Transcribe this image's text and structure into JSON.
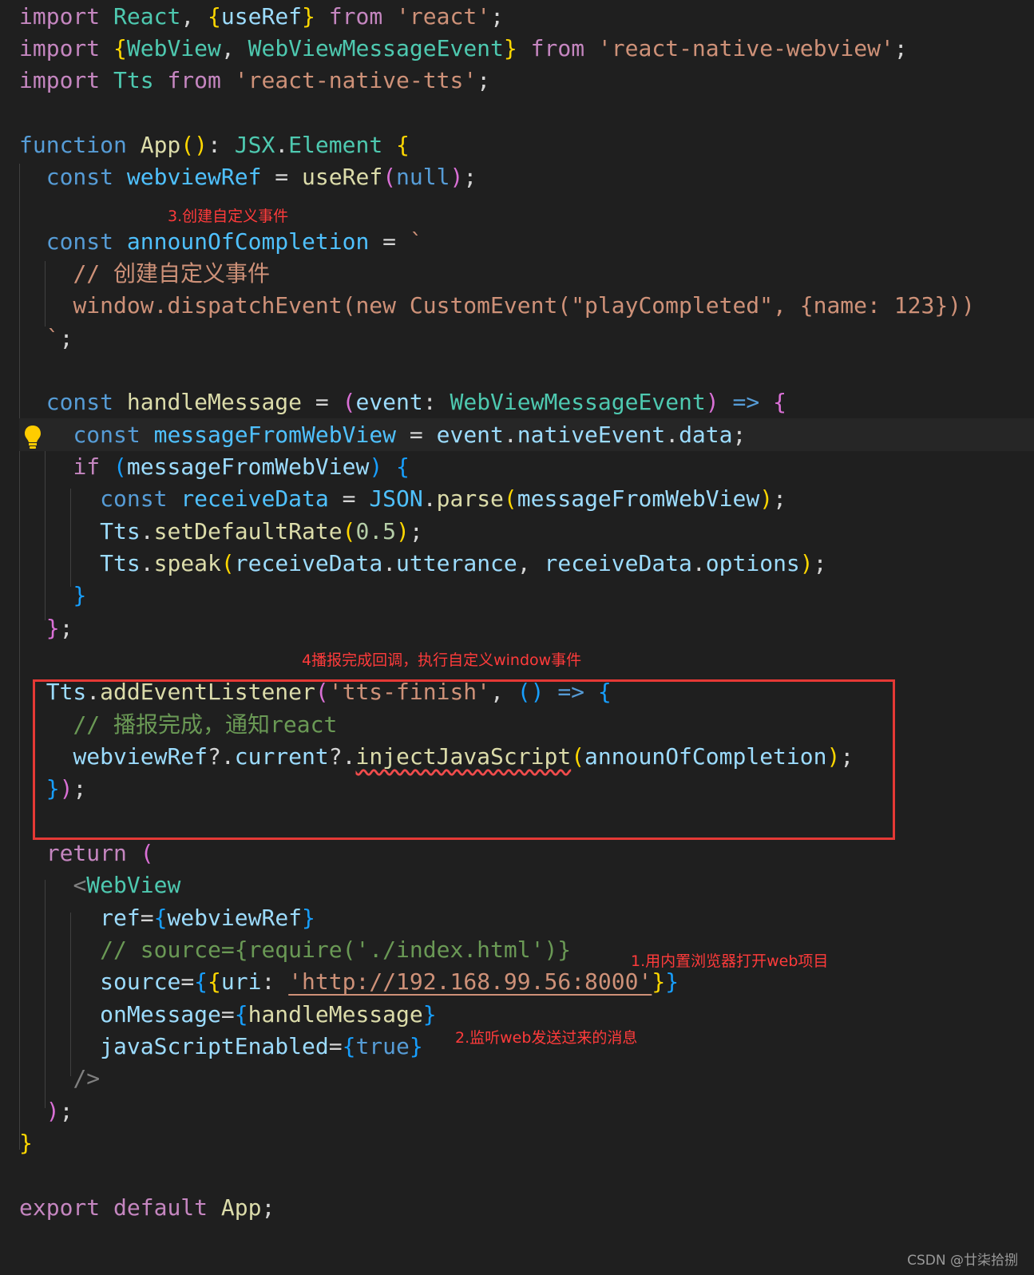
{
  "colors": {
    "background": "#1f1f1f",
    "keyword": "#c586c0",
    "storage": "#569cd6",
    "variable": "#9cdcfe",
    "constant": "#4fc1ff",
    "function": "#dcdcaa",
    "type": "#4ec9b0",
    "string": "#ce9178",
    "number": "#b5cea8",
    "comment": "#6a9955",
    "plain": "#d4d4d4",
    "bracket1": "#ffd700",
    "bracket2": "#da70d6",
    "bracket3": "#179fff",
    "annotation": "#ff3b3b"
  },
  "code_lines": [
    [
      [
        "k",
        "import"
      ],
      [
        "p",
        " "
      ],
      [
        "t",
        "React"
      ],
      [
        "p",
        ", "
      ],
      [
        "b1",
        "{"
      ],
      [
        "v",
        "useRef"
      ],
      [
        "b1",
        "}"
      ],
      [
        "p",
        " "
      ],
      [
        "k",
        "from"
      ],
      [
        "p",
        " "
      ],
      [
        "s",
        "'react'"
      ],
      [
        "p",
        ";"
      ]
    ],
    [
      [
        "k",
        "import"
      ],
      [
        "p",
        " "
      ],
      [
        "b1",
        "{"
      ],
      [
        "t",
        "WebView"
      ],
      [
        "p",
        ", "
      ],
      [
        "t",
        "WebViewMessageEvent"
      ],
      [
        "b1",
        "}"
      ],
      [
        "p",
        " "
      ],
      [
        "k",
        "from"
      ],
      [
        "p",
        " "
      ],
      [
        "s",
        "'react-native-webview'"
      ],
      [
        "p",
        ";"
      ]
    ],
    [
      [
        "k",
        "import"
      ],
      [
        "p",
        " "
      ],
      [
        "t",
        "Tts"
      ],
      [
        "p",
        " "
      ],
      [
        "k",
        "from"
      ],
      [
        "p",
        " "
      ],
      [
        "s",
        "'react-native-tts'"
      ],
      [
        "p",
        ";"
      ]
    ],
    [],
    [
      [
        "st",
        "function"
      ],
      [
        "p",
        " "
      ],
      [
        "f",
        "App"
      ],
      [
        "b1",
        "()"
      ],
      [
        "p",
        ": "
      ],
      [
        "t",
        "JSX"
      ],
      [
        "p",
        "."
      ],
      [
        "t",
        "Element"
      ],
      [
        "p",
        " "
      ],
      [
        "b1",
        "{"
      ]
    ],
    [
      [
        "p",
        "  "
      ],
      [
        "st",
        "const"
      ],
      [
        "p",
        " "
      ],
      [
        "c",
        "webviewRef"
      ],
      [
        "p",
        " = "
      ],
      [
        "f",
        "useRef"
      ],
      [
        "b2",
        "("
      ],
      [
        "st",
        "null"
      ],
      [
        "b2",
        ")"
      ],
      [
        "p",
        ";"
      ]
    ],
    [],
    [
      [
        "p",
        "  "
      ],
      [
        "st",
        "const"
      ],
      [
        "p",
        " "
      ],
      [
        "c",
        "announOfCompletion"
      ],
      [
        "p",
        " = "
      ],
      [
        "s",
        "`"
      ]
    ],
    [
      [
        "p",
        "    "
      ],
      [
        "s",
        "// 创建自定义事件"
      ]
    ],
    [
      [
        "p",
        "    "
      ],
      [
        "s",
        "window.dispatchEvent(new CustomEvent(\"playCompleted\", {name: 123}))"
      ]
    ],
    [
      [
        "p",
        "  "
      ],
      [
        "s",
        "`"
      ],
      [
        "p",
        ";"
      ]
    ],
    [],
    [
      [
        "p",
        "  "
      ],
      [
        "st",
        "const"
      ],
      [
        "p",
        " "
      ],
      [
        "f",
        "handleMessage"
      ],
      [
        "p",
        " = "
      ],
      [
        "b2",
        "("
      ],
      [
        "v",
        "event"
      ],
      [
        "p",
        ": "
      ],
      [
        "t",
        "WebViewMessageEvent"
      ],
      [
        "b2",
        ")"
      ],
      [
        "p",
        " "
      ],
      [
        "st",
        "=>"
      ],
      [
        "p",
        " "
      ],
      [
        "b2",
        "{"
      ]
    ],
    [
      [
        "p",
        "    "
      ],
      [
        "st",
        "const"
      ],
      [
        "p",
        " "
      ],
      [
        "c",
        "messageFromWebView"
      ],
      [
        "p",
        " = "
      ],
      [
        "v",
        "event"
      ],
      [
        "p",
        "."
      ],
      [
        "v",
        "nativeEvent"
      ],
      [
        "p",
        "."
      ],
      [
        "v",
        "data"
      ],
      [
        "p",
        ";"
      ]
    ],
    [
      [
        "p",
        "    "
      ],
      [
        "k",
        "if"
      ],
      [
        "p",
        " "
      ],
      [
        "b3",
        "("
      ],
      [
        "v",
        "messageFromWebView"
      ],
      [
        "b3",
        ")"
      ],
      [
        "p",
        " "
      ],
      [
        "b3",
        "{"
      ]
    ],
    [
      [
        "p",
        "      "
      ],
      [
        "st",
        "const"
      ],
      [
        "p",
        " "
      ],
      [
        "c",
        "receiveData"
      ],
      [
        "p",
        " = "
      ],
      [
        "c",
        "JSON"
      ],
      [
        "p",
        "."
      ],
      [
        "f",
        "parse"
      ],
      [
        "b1",
        "("
      ],
      [
        "v",
        "messageFromWebView"
      ],
      [
        "b1",
        ")"
      ],
      [
        "p",
        ";"
      ]
    ],
    [
      [
        "p",
        "      "
      ],
      [
        "v",
        "Tts"
      ],
      [
        "p",
        "."
      ],
      [
        "f",
        "setDefaultRate"
      ],
      [
        "b1",
        "("
      ],
      [
        "n",
        "0.5"
      ],
      [
        "b1",
        ")"
      ],
      [
        "p",
        ";"
      ]
    ],
    [
      [
        "p",
        "      "
      ],
      [
        "v",
        "Tts"
      ],
      [
        "p",
        "."
      ],
      [
        "f",
        "speak"
      ],
      [
        "b1",
        "("
      ],
      [
        "v",
        "receiveData"
      ],
      [
        "p",
        "."
      ],
      [
        "v",
        "utterance"
      ],
      [
        "p",
        ", "
      ],
      [
        "v",
        "receiveData"
      ],
      [
        "p",
        "."
      ],
      [
        "v",
        "options"
      ],
      [
        "b1",
        ")"
      ],
      [
        "p",
        ";"
      ]
    ],
    [
      [
        "p",
        "    "
      ],
      [
        "b3",
        "}"
      ]
    ],
    [
      [
        "p",
        "  "
      ],
      [
        "b2",
        "}"
      ],
      [
        "p",
        ";"
      ]
    ],
    [],
    [
      [
        "p",
        "  "
      ],
      [
        "v",
        "Tts"
      ],
      [
        "p",
        "."
      ],
      [
        "f",
        "addEventListener"
      ],
      [
        "b2",
        "("
      ],
      [
        "s",
        "'tts-finish'"
      ],
      [
        "p",
        ", "
      ],
      [
        "b3",
        "()"
      ],
      [
        "p",
        " "
      ],
      [
        "st",
        "=>"
      ],
      [
        "p",
        " "
      ],
      [
        "b3",
        "{"
      ]
    ],
    [
      [
        "p",
        "    "
      ],
      [
        "cm",
        "// 播报完成，通知react"
      ]
    ],
    [
      [
        "p",
        "    "
      ],
      [
        "v",
        "webviewRef"
      ],
      [
        "p",
        "?."
      ],
      [
        "v",
        "current"
      ],
      [
        "p",
        "?."
      ],
      [
        "fq",
        "injectJavaScript"
      ],
      [
        "b1",
        "("
      ],
      [
        "v",
        "announOfCompletion"
      ],
      [
        "b1",
        ")"
      ],
      [
        "p",
        ";"
      ]
    ],
    [
      [
        "p",
        "  "
      ],
      [
        "b3",
        "}"
      ],
      [
        "b2",
        ")"
      ],
      [
        "p",
        ";"
      ]
    ],
    [],
    [
      [
        "p",
        "  "
      ],
      [
        "k",
        "return"
      ],
      [
        "p",
        " "
      ],
      [
        "b2",
        "("
      ]
    ],
    [
      [
        "p",
        "    "
      ],
      [
        "g",
        "<"
      ],
      [
        "t",
        "WebView"
      ]
    ],
    [
      [
        "p",
        "      "
      ],
      [
        "v",
        "ref"
      ],
      [
        "p",
        "="
      ],
      [
        "b3",
        "{"
      ],
      [
        "v",
        "webviewRef"
      ],
      [
        "b3",
        "}"
      ]
    ],
    [
      [
        "p",
        "      "
      ],
      [
        "cm",
        "// source={require('./index.html')}"
      ]
    ],
    [
      [
        "p",
        "      "
      ],
      [
        "v",
        "source"
      ],
      [
        "p",
        "="
      ],
      [
        "b3",
        "{"
      ],
      [
        "b1",
        "{"
      ],
      [
        "v",
        "uri"
      ],
      [
        "p",
        ": "
      ],
      [
        "su",
        "'http://192.168.99.56:8000'"
      ],
      [
        "b1",
        "}"
      ],
      [
        "b3",
        "}"
      ]
    ],
    [
      [
        "p",
        "      "
      ],
      [
        "v",
        "onMessage"
      ],
      [
        "p",
        "="
      ],
      [
        "b3",
        "{"
      ],
      [
        "f",
        "handleMessage"
      ],
      [
        "b3",
        "}"
      ]
    ],
    [
      [
        "p",
        "      "
      ],
      [
        "v",
        "javaScriptEnabled"
      ],
      [
        "p",
        "="
      ],
      [
        "b3",
        "{"
      ],
      [
        "st",
        "true"
      ],
      [
        "b3",
        "}"
      ]
    ],
    [
      [
        "p",
        "    "
      ],
      [
        "g",
        "/>"
      ]
    ],
    [
      [
        "p",
        "  "
      ],
      [
        "b2",
        ")"
      ],
      [
        "p",
        ";"
      ]
    ],
    [
      [
        "b1",
        "}"
      ]
    ],
    [],
    [
      [
        "k",
        "export"
      ],
      [
        "p",
        " "
      ],
      [
        "k",
        "default"
      ],
      [
        "p",
        " "
      ],
      [
        "f",
        "App"
      ],
      [
        "p",
        ";"
      ]
    ]
  ],
  "annotations": {
    "step3": "3.创建自定义事件",
    "step4": "4播报完成回调，执行自定义window事件",
    "step1": "1.用内置浏览器打开web项目",
    "step2": "2.监听web发送过来的消息"
  },
  "watermark": "CSDN @廿柒拾捌",
  "icons": {
    "lightbulb": "lightbulb-icon"
  }
}
